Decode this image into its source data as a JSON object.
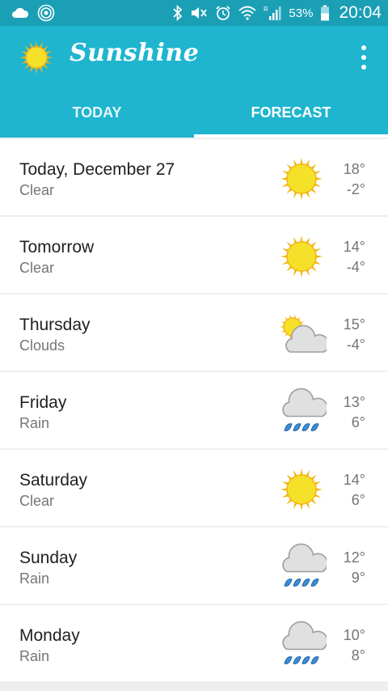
{
  "status_bar": {
    "battery": "53%",
    "time": "20:04",
    "icons": [
      "cloud-icon",
      "signal-rings-icon",
      "bluetooth-icon",
      "mute-icon",
      "alarm-icon",
      "wifi-icon",
      "cell-signal-icon",
      "battery-icon"
    ]
  },
  "app": {
    "title": "Sunshine",
    "logo_icon": "sun-icon",
    "overflow_icon": "more-vert-icon"
  },
  "tabs": [
    {
      "label": "TODAY",
      "active": false
    },
    {
      "label": "FORECAST",
      "active": true
    }
  ],
  "forecast": [
    {
      "day": "Today, December 27",
      "desc": "Clear",
      "hi": "18°",
      "lo": "-2°",
      "icon": "clear"
    },
    {
      "day": "Tomorrow",
      "desc": "Clear",
      "hi": "14°",
      "lo": "-4°",
      "icon": "clear"
    },
    {
      "day": "Thursday",
      "desc": "Clouds",
      "hi": "15°",
      "lo": "-4°",
      "icon": "clouds"
    },
    {
      "day": "Friday",
      "desc": "Rain",
      "hi": "13°",
      "lo": "6°",
      "icon": "rain"
    },
    {
      "day": "Saturday",
      "desc": "Clear",
      "hi": "14°",
      "lo": "6°",
      "icon": "clear"
    },
    {
      "day": "Sunday",
      "desc": "Rain",
      "hi": "12°",
      "lo": "9°",
      "icon": "rain"
    },
    {
      "day": "Monday",
      "desc": "Rain",
      "hi": "10°",
      "lo": "8°",
      "icon": "rain"
    }
  ],
  "colors": {
    "status_bar": "#1a9fb5",
    "app_bar": "#1fb5cf",
    "sun": "#f5e02a",
    "sun_rays": "#f4b515",
    "cloud": "#e0e0e0",
    "rain": "#3a8fd8"
  }
}
